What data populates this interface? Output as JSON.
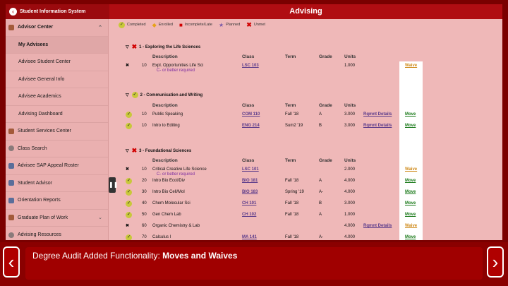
{
  "app_title": "Student Information System",
  "page_title": "Advising",
  "sidebar": {
    "items": [
      {
        "label": "Advisor Center",
        "type": "head",
        "icon": "folder-icon"
      },
      {
        "label": "My Advisees",
        "type": "active"
      },
      {
        "label": "Advisee Student Center",
        "type": "sub"
      },
      {
        "label": "Advisee General Info",
        "type": "sub"
      },
      {
        "label": "Advisee Academics",
        "type": "sub"
      },
      {
        "label": "Advising Dashboard",
        "type": "sub"
      },
      {
        "label": "Student Services Center",
        "type": "top",
        "icon": "services-icon"
      },
      {
        "label": "Class Search",
        "type": "top",
        "icon": "search-icon"
      },
      {
        "label": "Advisee SAP Appeal Roster",
        "type": "top",
        "icon": "roster-icon"
      },
      {
        "label": "Student Advisor",
        "type": "top",
        "icon": "advisor-icon"
      },
      {
        "label": "Orientation Reports",
        "type": "top",
        "icon": "report-icon"
      },
      {
        "label": "Graduate Plan of Work",
        "type": "top",
        "icon": "plan-icon"
      },
      {
        "label": "Advising Resources",
        "type": "top",
        "icon": "resources-icon"
      }
    ]
  },
  "legend": {
    "completed": "Completed",
    "enrolled": "Enrolled",
    "incomplete": "Incomplete/Late",
    "planned": "Planned",
    "unmet": "Unmet"
  },
  "headers": {
    "description": "Description",
    "class": "Class",
    "term": "Term",
    "grade": "Grade",
    "units": "Units"
  },
  "sections": [
    {
      "title": "1 - Exploring the Life Sciences",
      "rows": [
        {
          "status": "unmet",
          "num": "10",
          "desc": "Expl. Opportunities Life Sci",
          "note": "C- or better required",
          "cls": "LSC 103",
          "term": "",
          "grade": "",
          "units": "1.000",
          "rqmnt": "",
          "action": "Waive"
        }
      ]
    },
    {
      "title": "2 - Communication and Writing",
      "rows": [
        {
          "status": "completed",
          "num": "10",
          "desc": "Public Speaking",
          "note": "",
          "cls": "COM 110",
          "term": "Fall '18",
          "grade": "A",
          "units": "3.000",
          "rqmnt": "Rqmnt Details",
          "action": "Move"
        },
        {
          "status": "completed",
          "num": "10",
          "desc": "Intro to Editing",
          "note": "",
          "cls": "ENG 214",
          "term": "Sum2 '19",
          "grade": "B",
          "units": "3.000",
          "rqmnt": "Rqmnt Details",
          "action": "Move"
        }
      ]
    },
    {
      "title": "3 - Foundational Sciences",
      "rows": [
        {
          "status": "unmet",
          "num": "10",
          "desc": "Critical Creative Life Science",
          "note": "C- or better required",
          "cls": "LSC 101",
          "term": "",
          "grade": "",
          "units": "2.000",
          "rqmnt": "",
          "action": "Waive"
        },
        {
          "status": "completed",
          "num": "20",
          "desc": "Intro Bio Ecol/Div",
          "note": "",
          "cls": "BIO 181",
          "term": "Fall '18",
          "grade": "A",
          "units": "4.000",
          "rqmnt": "",
          "action": "Move"
        },
        {
          "status": "completed",
          "num": "30",
          "desc": "Intro Bio Cell/Mol",
          "note": "",
          "cls": "BIO 183",
          "term": "Spring '19",
          "grade": "A-",
          "units": "4.000",
          "rqmnt": "",
          "action": "Move"
        },
        {
          "status": "completed",
          "num": "40",
          "desc": "Chem Molecular Sci",
          "note": "",
          "cls": "CH 101",
          "term": "Fall '18",
          "grade": "B",
          "units": "3.000",
          "rqmnt": "",
          "action": "Move"
        },
        {
          "status": "completed",
          "num": "50",
          "desc": "Gen Chem Lab",
          "note": "",
          "cls": "CH 102",
          "term": "Fall '18",
          "grade": "A",
          "units": "1.000",
          "rqmnt": "",
          "action": "Move"
        },
        {
          "status": "unmet",
          "num": "60",
          "desc": "Organic Chemistry & Lab",
          "note": "",
          "cls": "",
          "term": "",
          "grade": "",
          "units": "4.000",
          "rqmnt": "Rqmnt Details",
          "action": "Waive"
        },
        {
          "status": "completed",
          "num": "70",
          "desc": "Calculus I",
          "note": "",
          "cls": "MA 141",
          "term": "Fall '18",
          "grade": "A-",
          "units": "4.000",
          "rqmnt": "",
          "action": "Move"
        }
      ]
    }
  ],
  "caption": {
    "prefix": "Degree Audit Added Functionality: ",
    "bold": "Moves and Waives"
  }
}
